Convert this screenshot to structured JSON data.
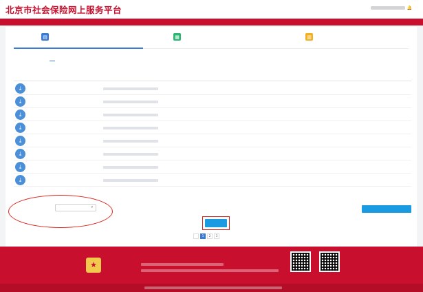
{
  "header": {
    "title": "北京市社会保险网上服务平台",
    "user_name": "",
    "link_1": "",
    "link_2": ""
  },
  "date_bar": {
    "date": ""
  },
  "steps": [
    {
      "title": "",
      "subtitle": ""
    },
    {
      "title": "",
      "subtitle": ""
    },
    {
      "title": "",
      "subtitle": ""
    }
  ],
  "tabs": [
    {
      "label": ""
    },
    {
      "label": ""
    }
  ],
  "table": {
    "col_name": "",
    "col_id": "",
    "col_group": "",
    "col_group_sub1": "",
    "col_group_sub2": "",
    "col_last": "",
    "rows": [
      {
        "name": "",
        "c1": "",
        "c2": "",
        "c3": ""
      },
      {
        "name": "",
        "c1": "",
        "c2": "",
        "c3": ""
      },
      {
        "name": "",
        "c1": "",
        "c2": "",
        "c3": ""
      },
      {
        "name": "",
        "c1": "",
        "c2": "",
        "c3": ""
      },
      {
        "name": "",
        "c1": "",
        "c2": "",
        "c3": ""
      },
      {
        "name": "",
        "c1": "",
        "c2": "",
        "c3": ""
      },
      {
        "name": "",
        "c1": "",
        "c2": "",
        "c3": ""
      },
      {
        "name": "",
        "c1": "",
        "c2": "",
        "c3": ""
      }
    ]
  },
  "ratio_select": {
    "label": "",
    "value": ""
  },
  "summary": {
    "tag": "",
    "text": "",
    "count": "",
    "suffix": ""
  },
  "import_button": {
    "label": ""
  },
  "step3": {
    "label": ""
  },
  "confirm_button": {
    "label": ""
  },
  "pager": {
    "prev": "",
    "pages": [
      "1",
      "2",
      "3"
    ],
    "next": ""
  },
  "footer": {
    "links": [
      "",
      "",
      "",
      ""
    ],
    "qr_1_label": "",
    "qr_2_label": ""
  },
  "colors": {
    "brand_red": "#c8102e",
    "accent_blue": "#3a7bd5",
    "button_blue": "#1a9ae0"
  }
}
